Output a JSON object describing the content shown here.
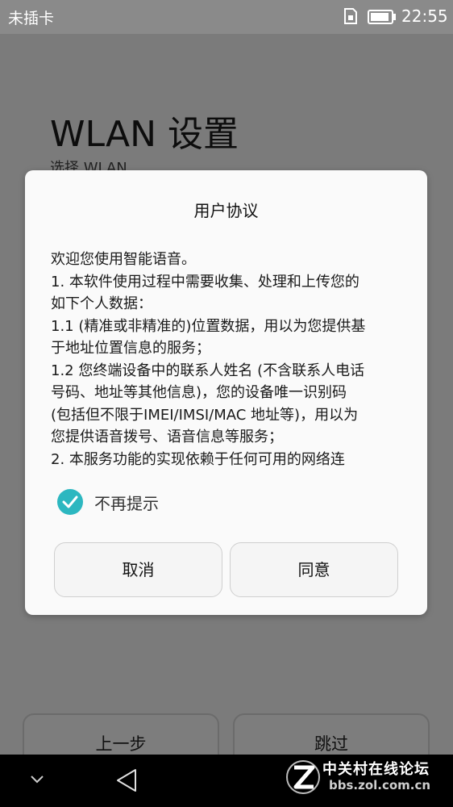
{
  "status_bar": {
    "carrier": "未插卡",
    "time": "22:55",
    "icons": [
      "sim-card-icon",
      "battery-icon"
    ]
  },
  "background_screen": {
    "title": "WLAN 设置",
    "subtitle": "选择 WLAN",
    "prev_button": "上一步",
    "skip_button": "跳过"
  },
  "dialog": {
    "title": "用户协议",
    "body_lines": [
      "欢迎您使用智能语音。",
      "1. 本软件使用过程中需要收集、处理和上传您的",
      "如下个人数据：",
      "1.1 (精准或非精准的)位置数据，用以为您提供基",
      "于地址位置信息的服务；",
      "1.2 您终端设备中的联系人姓名 (不含联系人电话",
      "号码、地址等其他信息)，您的设备唯一识别码",
      "(包括但不限于IMEI/IMSI/MAC 地址等)，用以为",
      "您提供语音拨号、语音信息等服务；",
      "2. 本服务功能的实现依赖于任何可用的网络连"
    ],
    "checkbox": {
      "label": "不再提示",
      "checked": true
    },
    "cancel_button": "取消",
    "agree_button": "同意",
    "accent_color": "#2cb7c0"
  },
  "nav_bar": {
    "icons": [
      "chevron-down-icon",
      "back-triangle-icon"
    ]
  },
  "watermark": {
    "name": "中关村在线论坛",
    "url": "bbs.zol.com.cn"
  }
}
